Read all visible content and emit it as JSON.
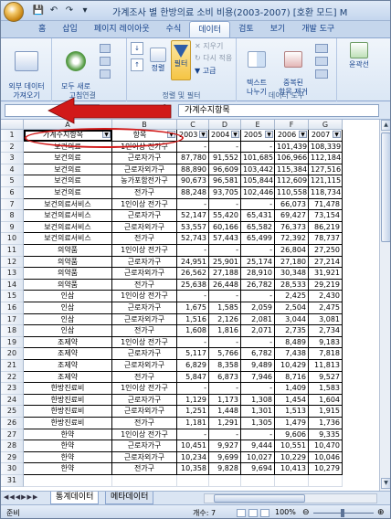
{
  "window": {
    "title": "가계조사 별 한방의료 소비 비용(2003-2007) [호환 모드] M",
    "qat": [
      "💾",
      "↶",
      "↷",
      "▾"
    ]
  },
  "tabs": [
    "홈",
    "삽입",
    "페이지 레이아웃",
    "수식",
    "데이터",
    "검토",
    "보기",
    "개발 도구"
  ],
  "active_tab": "데이터",
  "ribbon": {
    "external_data": "외부 데이터\n가져오기",
    "refresh_all": "모두 새로\n고침",
    "group_connection": "연결",
    "sort": "정렬",
    "filter": "필터",
    "clear": "지우기",
    "reapply": "다시 적용",
    "advanced": "고급",
    "group_sort_filter": "정렬 및 필터",
    "text_to_columns": "텍스트\n나누기",
    "remove_duplicates": "중복된\n항목 제거",
    "group_data_tools": "데이터 도구",
    "outline": "윤곽선"
  },
  "formula_bar": {
    "name_box": "A1",
    "fx": "fx",
    "value": "가계수지항목"
  },
  "columns": [
    "A",
    "B",
    "C",
    "D",
    "E",
    "F",
    "G"
  ],
  "header_row": [
    "가계수지항목",
    "항목",
    "2003",
    "2004",
    "2005",
    "2006",
    "2007"
  ],
  "rows": [
    [
      "보건의료",
      "1인이상 전가구",
      "-",
      "-",
      "-",
      "101,439",
      "108,339"
    ],
    [
      "보건의료",
      "근로자가구",
      "87,780",
      "91,552",
      "101,685",
      "106,966",
      "112,184"
    ],
    [
      "보건의료",
      "근로자외가구",
      "88,890",
      "96,609",
      "103,442",
      "115,384",
      "127,516"
    ],
    [
      "보건의료",
      "농가포함전가구",
      "90,673",
      "96,581",
      "105,844",
      "112,609",
      "121,115"
    ],
    [
      "보건의료",
      "전가구",
      "88,248",
      "93,705",
      "102,446",
      "110,558",
      "118,734"
    ],
    [
      "보건의료서비스",
      "1인이상 전가구",
      "-",
      "-",
      "-",
      "66,073",
      "71,478"
    ],
    [
      "보건의료서비스",
      "근로자가구",
      "52,147",
      "55,420",
      "65,431",
      "69,427",
      "73,154"
    ],
    [
      "보건의료서비스",
      "근로자외가구",
      "53,557",
      "60,166",
      "65,582",
      "76,373",
      "86,219"
    ],
    [
      "보건의료서비스",
      "전가구",
      "52,743",
      "57,443",
      "65,499",
      "72,392",
      "78,737"
    ],
    [
      "의약품",
      "1인이상 전가구",
      "-",
      "-",
      "-",
      "26,804",
      "27,250"
    ],
    [
      "의약품",
      "근로자가구",
      "24,951",
      "25,901",
      "25,174",
      "27,180",
      "27,214"
    ],
    [
      "의약품",
      "근로자외가구",
      "26,562",
      "27,188",
      "28,910",
      "30,348",
      "31,921"
    ],
    [
      "의약품",
      "전가구",
      "25,638",
      "26,448",
      "26,782",
      "28,533",
      "29,219"
    ],
    [
      "인삼",
      "1인이상 전가구",
      "-",
      "-",
      "-",
      "2,425",
      "2,430"
    ],
    [
      "인삼",
      "근로자가구",
      "1,675",
      "1,585",
      "2,059",
      "2,504",
      "2,475"
    ],
    [
      "인삼",
      "근로자외가구",
      "1,516",
      "2,126",
      "2,081",
      "3,044",
      "3,081"
    ],
    [
      "인삼",
      "전가구",
      "1,608",
      "1,816",
      "2,071",
      "2,735",
      "2,734"
    ],
    [
      "조제약",
      "1인이상 전가구",
      "-",
      "-",
      "-",
      "8,489",
      "9,183"
    ],
    [
      "조제약",
      "근로자가구",
      "5,117",
      "5,766",
      "6,782",
      "7,438",
      "7,818"
    ],
    [
      "조제약",
      "근로자외가구",
      "6,829",
      "8,358",
      "9,489",
      "10,429",
      "11,813"
    ],
    [
      "조제약",
      "전가구",
      "5,847",
      "6,873",
      "7,946",
      "8,716",
      "9,527"
    ],
    [
      "한방진료비",
      "1인이상 전가구",
      "-",
      "-",
      "-",
      "1,409",
      "1,583"
    ],
    [
      "한방진료비",
      "근로자가구",
      "1,129",
      "1,173",
      "1,308",
      "1,454",
      "1,604"
    ],
    [
      "한방진료비",
      "근로자외가구",
      "1,251",
      "1,448",
      "1,301",
      "1,513",
      "1,915"
    ],
    [
      "한방진료비",
      "전가구",
      "1,181",
      "1,291",
      "1,305",
      "1,479",
      "1,736"
    ],
    [
      "한약",
      "1인이상 전가구",
      "-",
      "-",
      "-",
      "9,606",
      "9,335"
    ],
    [
      "한약",
      "근로자가구",
      "10,451",
      "9,927",
      "9,444",
      "10,551",
      "10,470"
    ],
    [
      "한약",
      "근로자외가구",
      "10,234",
      "9,699",
      "10,027",
      "10,229",
      "10,046"
    ],
    [
      "한약",
      "전가구",
      "10,358",
      "9,828",
      "9,694",
      "10,413",
      "10,279"
    ],
    [
      "",
      "",
      "",
      "",
      "",
      "",
      ""
    ]
  ],
  "sheets": [
    "통계데이터",
    "메타데이터"
  ],
  "status": {
    "ready": "준비",
    "count": "개수: 7",
    "zoom": "100%"
  },
  "colors": {
    "annotation": "#d11919",
    "ribbon": "#dbe7f5"
  }
}
